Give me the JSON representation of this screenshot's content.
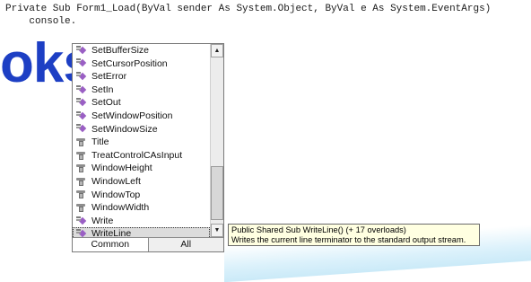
{
  "editor": {
    "line1": "Private Sub Form1_Load(ByVal sender As System.Object, ByVal e As System.EventArgs)",
    "line2": "    console."
  },
  "watermark": {
    "text": "oks"
  },
  "intellisense": {
    "items": [
      {
        "label": "SetBufferSize",
        "icon": "method-icon"
      },
      {
        "label": "SetCursorPosition",
        "icon": "method-icon"
      },
      {
        "label": "SetError",
        "icon": "method-icon"
      },
      {
        "label": "SetIn",
        "icon": "method-icon"
      },
      {
        "label": "SetOut",
        "icon": "method-icon"
      },
      {
        "label": "SetWindowPosition",
        "icon": "method-icon"
      },
      {
        "label": "SetWindowSize",
        "icon": "method-icon"
      },
      {
        "label": "Title",
        "icon": "property-icon"
      },
      {
        "label": "TreatControlCAsInput",
        "icon": "property-icon"
      },
      {
        "label": "WindowHeight",
        "icon": "property-icon"
      },
      {
        "label": "WindowLeft",
        "icon": "property-icon"
      },
      {
        "label": "WindowTop",
        "icon": "property-icon"
      },
      {
        "label": "WindowWidth",
        "icon": "property-icon"
      },
      {
        "label": "Write",
        "icon": "method-icon"
      },
      {
        "label": "WriteLine",
        "icon": "method-icon"
      }
    ],
    "selected_label": "WriteLine",
    "scrollbar": {
      "up_icon": "scroll-up-arrow-icon",
      "down_icon": "scroll-down-arrow-icon"
    },
    "tabs": {
      "common": "Common",
      "all": "All"
    }
  },
  "tooltip": {
    "signature": "Public Shared Sub WriteLine() (+ 17 overloads)",
    "description": "Writes the current line terminator to the standard output stream."
  },
  "colors": {
    "watermark": "#1d3fc4",
    "tooltip_bg": "#ffffe1",
    "method_icon": "#9a5fc4"
  }
}
